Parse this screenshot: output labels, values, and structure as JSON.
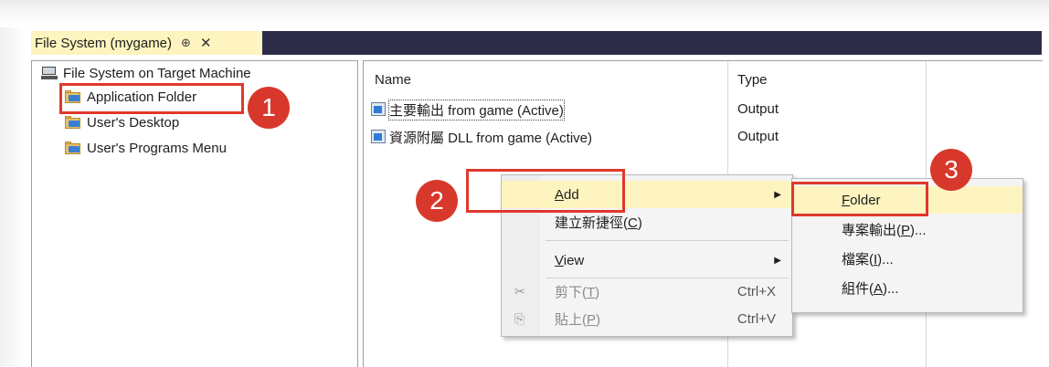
{
  "tab": {
    "title": "File System (mygame)",
    "pin": "⊕",
    "close": "✕"
  },
  "tree": {
    "root": "File System on Target Machine",
    "items": [
      {
        "label": "Application Folder"
      },
      {
        "label": "User's Desktop"
      },
      {
        "label": "User's Programs Menu"
      }
    ]
  },
  "list": {
    "columns": [
      "Name",
      "Type"
    ],
    "rows": [
      {
        "name": "主要輸出 from game (Active)",
        "type": "Output"
      },
      {
        "name": "資源附屬 DLL from game (Active)",
        "type": "Output"
      }
    ]
  },
  "context_menu": {
    "add": {
      "label": "Add",
      "mnemonic": "A",
      "rest": "dd"
    },
    "create_shortcut": {
      "label": "建立新捷徑(C)",
      "pre": "建立新捷徑(",
      "mnemonic": "C",
      "post": ")"
    },
    "view": {
      "label": "View",
      "mnemonic": "V",
      "rest": "iew"
    },
    "cut": {
      "pre": "剪下(",
      "mnemonic": "T",
      "post": ")",
      "shortcut": "Ctrl+X"
    },
    "paste": {
      "pre": "貼上(",
      "mnemonic": "P",
      "post": ")",
      "shortcut": "Ctrl+V"
    }
  },
  "submenu": {
    "folder": {
      "mnemonic": "F",
      "rest": "older"
    },
    "project_output": {
      "pre": "專案輸出(",
      "mnemonic": "P",
      "post": ")..."
    },
    "file": {
      "pre": "檔案(",
      "mnemonic": "I",
      "post": ")..."
    },
    "assembly": {
      "pre": "組件(",
      "mnemonic": "A",
      "post": ")..."
    }
  },
  "callouts": [
    "1",
    "2",
    "3"
  ],
  "colors": {
    "accent_red": "#d8382b",
    "highlight": "#fdf4bf",
    "tabstrip": "#2d2d4a"
  }
}
